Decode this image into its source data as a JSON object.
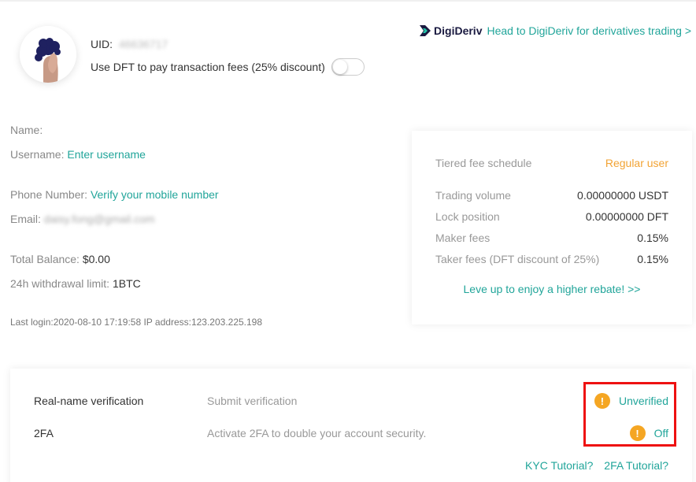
{
  "profile": {
    "uid_label": "UID:",
    "uid_value": "46636717",
    "dft_label": "Use DFT to pay transaction fees (25% discount)",
    "dft_toggle_on": false
  },
  "digideriv": {
    "brand": "DigiDeriv",
    "link_text": "Head to DigiDeriv for derivatives trading >"
  },
  "account": {
    "name_label": "Name:",
    "username_label": "Username:",
    "username_link": "Enter username",
    "phone_label": "Phone Number:",
    "phone_link": "Verify your mobile number",
    "email_label": "Email:",
    "email_value": "daisy.fong@gmail.com",
    "balance_label": "Total Balance:",
    "balance_value": "$0.00",
    "withdraw_label": "24h withdrawal limit:",
    "withdraw_value": "1BTC",
    "last_login": "Last login:2020-08-10 17:19:58 IP address:123.203.225.198"
  },
  "fees": {
    "schedule_label": "Tiered fee schedule",
    "user_level": "Regular user",
    "rows": [
      {
        "label": "Trading volume",
        "value": "0.00000000 USDT"
      },
      {
        "label": "Lock position",
        "value": "0.00000000 DFT"
      },
      {
        "label": "Maker fees",
        "value": "0.15%"
      },
      {
        "label": "Taker fees (DFT discount of 25%)",
        "value": "0.15%"
      }
    ],
    "levelup_link": "Leve up to enjoy a higher rebate! >>"
  },
  "verification": {
    "rows": [
      {
        "label": "Real-name verification",
        "desc": "Submit verification",
        "status": "Unverified",
        "icon": "warning-icon"
      },
      {
        "label": "2FA",
        "desc": "Activate 2FA to double your account security.",
        "status": "Off",
        "icon": "warning-icon"
      }
    ],
    "kyc_tutorial": "KYC Tutorial?",
    "twofa_tutorial": "2FA Tutorial?",
    "warn_glyph": "!"
  },
  "colors": {
    "accent": "#21a59a",
    "warning": "#f5a623",
    "regular_user": "#f2a334",
    "highlight": "#ee1111"
  }
}
